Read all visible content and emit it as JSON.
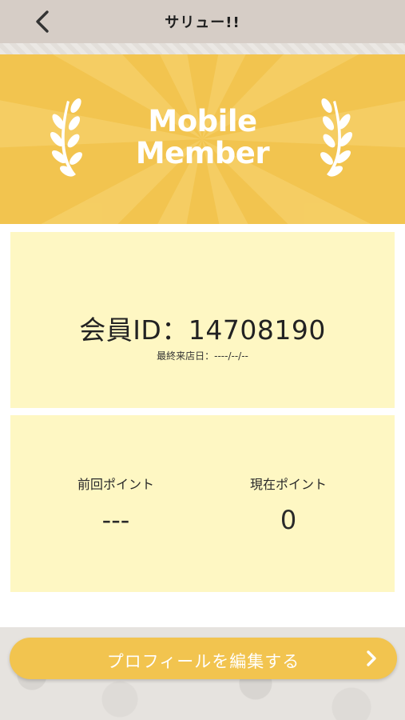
{
  "header": {
    "title": "サリュー!!",
    "back_icon": "chevron-left-icon"
  },
  "banner": {
    "title_line1": "Mobile",
    "title_line2": "Member",
    "background_color": "#f2c44f",
    "ray_color": "#f6d16a",
    "icons": [
      "laurel-left-icon",
      "laurel-right-icon"
    ]
  },
  "member_card": {
    "id_label": "会員ID：",
    "id_value": "14708190",
    "last_visit_label": "最終来店日：",
    "last_visit_value": "----/--/--",
    "background_color": "#fef7c3"
  },
  "points_card": {
    "previous_label": "前回ポイント",
    "previous_value": "---",
    "current_label": "現在ポイント",
    "current_value": "0"
  },
  "footer": {
    "edit_profile_label": "プロフィールを編集する",
    "edit_profile_icon": "chevron-right-icon",
    "button_color": "#f2c44f"
  }
}
